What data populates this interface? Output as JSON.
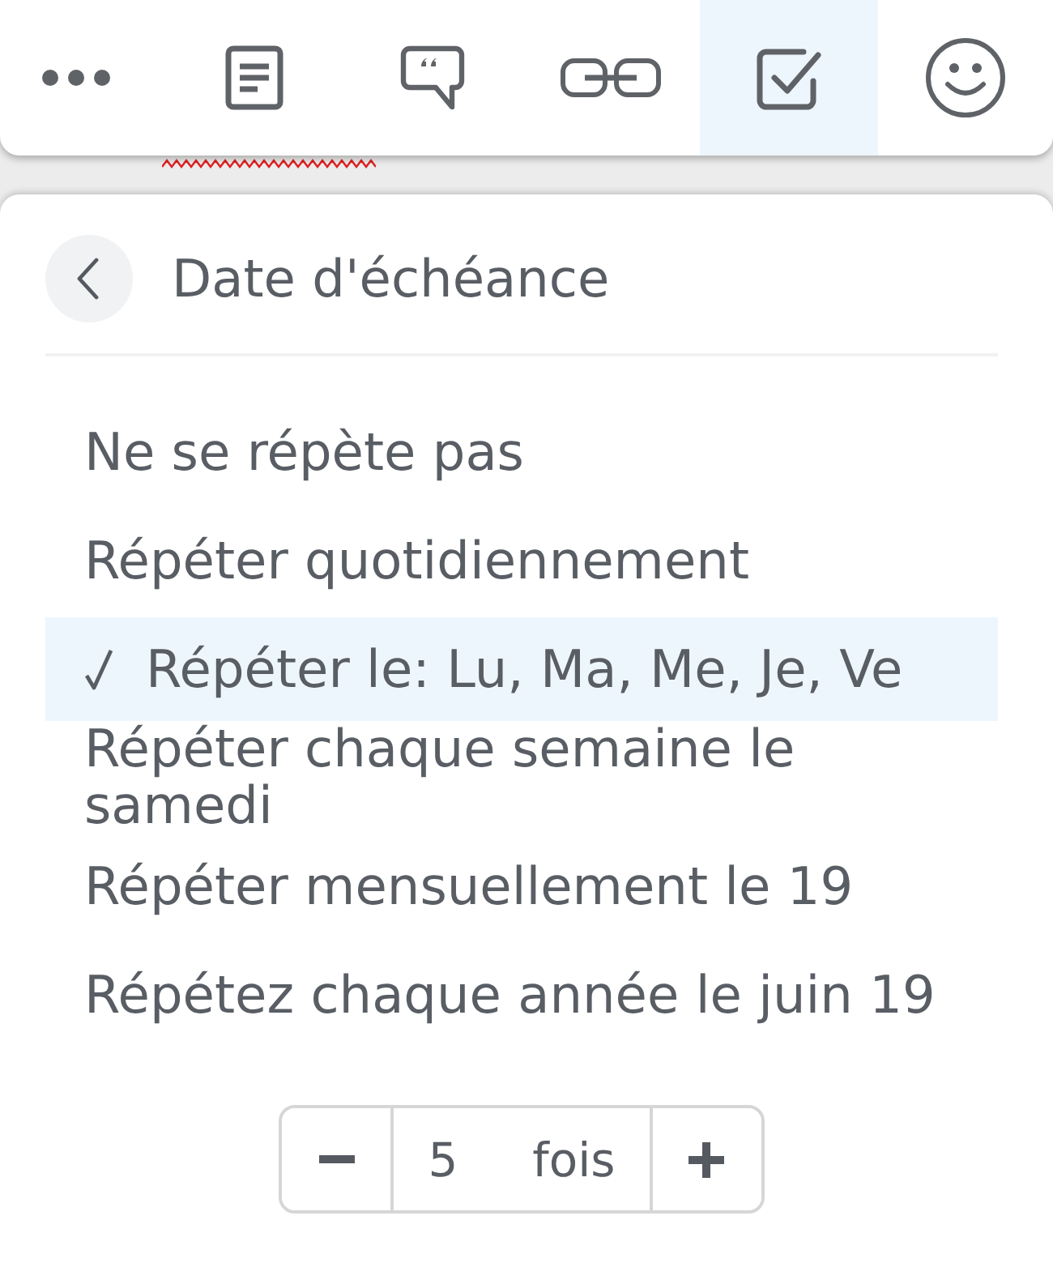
{
  "toolbar": {
    "items": [
      {
        "kind": "more",
        "selected": false
      },
      {
        "kind": "note",
        "selected": false
      },
      {
        "kind": "quote",
        "selected": false
      },
      {
        "kind": "link",
        "selected": false
      },
      {
        "kind": "checkbox",
        "selected": true
      },
      {
        "kind": "emoji",
        "selected": false
      }
    ]
  },
  "panel": {
    "title": "Date d'échéance",
    "options": [
      {
        "label": "Ne se répète pas",
        "selected": false
      },
      {
        "label": "Répéter quotidiennement",
        "selected": false
      },
      {
        "label": "Répéter le: Lu, Ma, Me, Je, Ve",
        "selected": true
      },
      {
        "label": "Répéter chaque semaine le samedi",
        "selected": false
      },
      {
        "label": "Répéter mensuellement le 19",
        "selected": false
      },
      {
        "label": "Répétez chaque année le juin 19",
        "selected": false
      }
    ],
    "counter": {
      "value": "5",
      "unit": "fois"
    }
  }
}
